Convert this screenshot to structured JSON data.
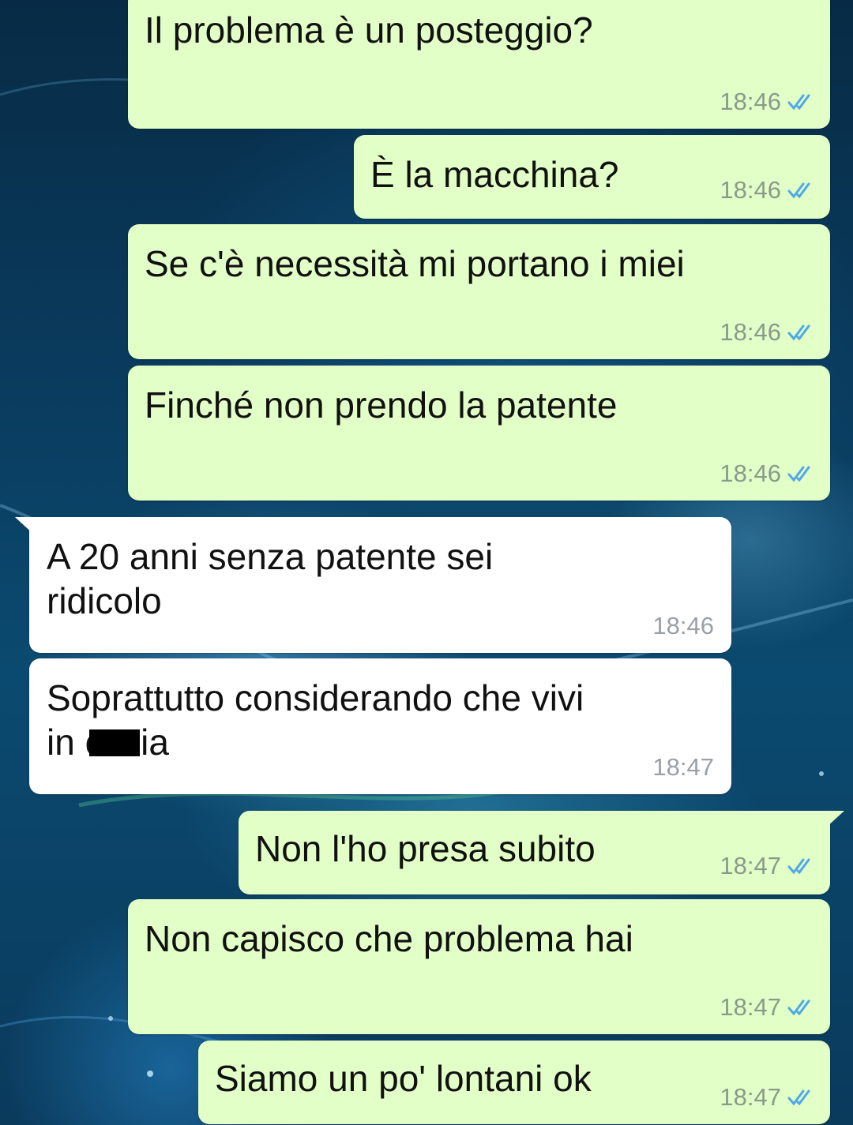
{
  "conversation": {
    "messages": [
      {
        "text": "Il problema è un posteggio?",
        "time": "18:46",
        "direction": "outgoing",
        "status": "read"
      },
      {
        "text": "È la macchina?",
        "time": "18:46",
        "direction": "outgoing",
        "status": "read"
      },
      {
        "text": "Se c'è necessità mi portano i miei",
        "time": "18:46",
        "direction": "outgoing",
        "status": "read"
      },
      {
        "text": "Finché non prendo la patente",
        "time": "18:46",
        "direction": "outgoing",
        "status": "read"
      },
      {
        "text": "A 20 anni senza patente sei\nridicolo",
        "time": "18:46",
        "direction": "incoming"
      },
      {
        "text_before": "Soprattutto considerando che vivi\nin c",
        "text_after": "nia",
        "time": "18:47",
        "direction": "incoming"
      },
      {
        "text": "Non l'ho presa subito",
        "time": "18:47",
        "direction": "outgoing",
        "status": "read"
      },
      {
        "text": "Non capisco che problema hai",
        "time": "18:47",
        "direction": "outgoing",
        "status": "read"
      },
      {
        "text": "Siamo un po' lontani ok",
        "time": "18:47",
        "direction": "outgoing",
        "status": "read"
      }
    ]
  },
  "colors": {
    "outgoing_bubble": "#e2ffc7",
    "incoming_bubble": "#ffffff",
    "read_ticks": "#4fa8e8"
  },
  "icons": {
    "read_receipt": "double-check-icon"
  }
}
